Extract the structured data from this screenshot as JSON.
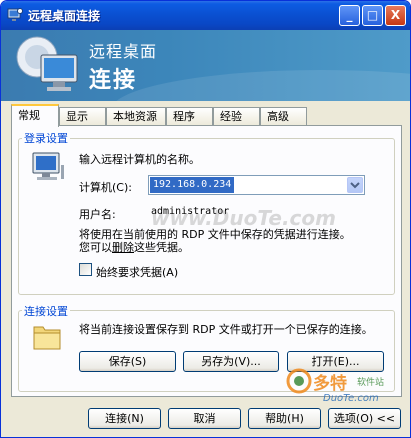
{
  "window": {
    "title": "远程桌面连接"
  },
  "titlebar": {
    "minimize": "_",
    "maximize": "□",
    "close": "X"
  },
  "banner": {
    "subtitle": "远程桌面",
    "title": "连接"
  },
  "tabs": [
    {
      "label": "常规",
      "active": true
    },
    {
      "label": "显示"
    },
    {
      "label": "本地资源"
    },
    {
      "label": "程序"
    },
    {
      "label": "经验"
    },
    {
      "label": "高级"
    }
  ],
  "logon": {
    "group_label": "登录设置",
    "instruction": "输入远程计算机的名称。",
    "computer_label": "计算机(C):",
    "computer_value": "192.168.0.234",
    "username_label": "用户名:",
    "username_value": "administrator",
    "saved_cred_line1": "将使用在当前使用的 RDP 文件中保存的凭据进行连接。",
    "saved_cred_prefix": "您可以",
    "delete_link": "删除",
    "saved_cred_suffix": "这些凭据。",
    "always_ask_label": "始终要求凭据(A)",
    "always_ask_checked": false
  },
  "connection": {
    "group_label": "连接设置",
    "description": "将当前连接设置保存到 RDP 文件或打开一个已保存的连接。",
    "save": "保存(S)",
    "save_as": "另存为(V)...",
    "open": "打开(E)..."
  },
  "footer": {
    "connect": "连接(N)",
    "cancel": "取消",
    "help": "帮助(H)",
    "options": "选项(O) <<"
  },
  "watermark": {
    "text": "www.DuoTe.com",
    "logo_main": "多特",
    "logo_sub": "软件站",
    "logo_url": "DuoTe.com"
  },
  "colors": {
    "accent": "#0046d5",
    "titlebar": "#0a4fd0",
    "banner": "#3c86ba",
    "selection": "#316ac5"
  }
}
